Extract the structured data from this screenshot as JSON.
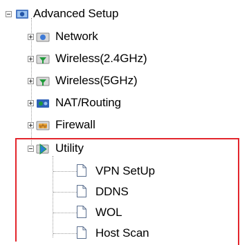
{
  "tree": {
    "root": {
      "label": "Advanced Setup",
      "icon": "advanced-setup-folder-icon",
      "expanded": true
    },
    "children": [
      {
        "label": "Network",
        "icon": "network-icon",
        "expanded": false
      },
      {
        "label": "Wireless(2.4GHz)",
        "icon": "wireless-antenna-icon",
        "expanded": false
      },
      {
        "label": "Wireless(5GHz)",
        "icon": "wireless-antenna-icon",
        "expanded": false
      },
      {
        "label": "NAT/Routing",
        "icon": "nat-routing-icon",
        "expanded": false
      },
      {
        "label": "Firewall",
        "icon": "firewall-icon",
        "expanded": false
      },
      {
        "label": "Utility",
        "icon": "utility-folder-icon",
        "expanded": true,
        "children": [
          {
            "label": "VPN SetUp",
            "icon": "document-icon"
          },
          {
            "label": "DDNS",
            "icon": "document-icon"
          },
          {
            "label": "WOL",
            "icon": "document-icon"
          },
          {
            "label": "Host Scan",
            "icon": "document-icon"
          }
        ]
      }
    ]
  },
  "highlight": {
    "target": "Utility",
    "color": "#e3242b"
  }
}
